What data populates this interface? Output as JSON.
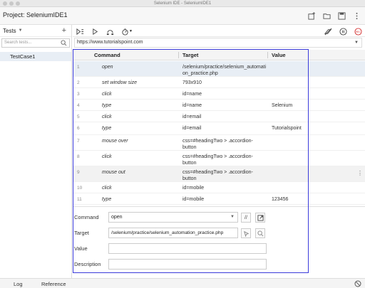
{
  "window": {
    "title": "Selenium IDE - SeleniumIDE1"
  },
  "project": {
    "label": "Project:",
    "name": "SeleniumIDE1"
  },
  "sidebar": {
    "tests_label": "Tests",
    "search_placeholder": "Search tests...",
    "test_cases": [
      "TestCase1"
    ]
  },
  "url": {
    "value": "https://www.tutorialspoint.com"
  },
  "grid": {
    "headers": {
      "command": "Command",
      "target": "Target",
      "value": "Value"
    },
    "rows": [
      {
        "num": "1",
        "command": "open",
        "target": "/selenium/practice/selenium_automation_practice.php",
        "value": ""
      },
      {
        "num": "2",
        "command": "set window size",
        "target": "793x910",
        "value": ""
      },
      {
        "num": "3",
        "command": "click",
        "target": "id=name",
        "value": ""
      },
      {
        "num": "4",
        "command": "type",
        "target": "id=name",
        "value": "Selenium"
      },
      {
        "num": "5",
        "command": "click",
        "target": "id=email",
        "value": ""
      },
      {
        "num": "6",
        "command": "type",
        "target": "id=email",
        "value": "Tutorialspoint"
      },
      {
        "num": "7",
        "command": "mouse over",
        "target": "css=#headingTwo > .accordion-button",
        "value": ""
      },
      {
        "num": "8",
        "command": "click",
        "target": "css=#headingTwo > .accordion-button",
        "value": ""
      },
      {
        "num": "9",
        "command": "mouse out",
        "target": "css=#headingTwo > .accordion-button",
        "value": ""
      },
      {
        "num": "10",
        "command": "click",
        "target": "id=mobile",
        "value": ""
      },
      {
        "num": "11",
        "command": "type",
        "target": "id=mobile",
        "value": "123456"
      }
    ]
  },
  "editor": {
    "command_label": "Command",
    "command_value": "open",
    "comment_btn": "//",
    "target_label": "Target",
    "target_value": "/selenium/practice/selenium_automation_practice.php",
    "value_label": "Value",
    "value_value": "",
    "description_label": "Description",
    "description_value": ""
  },
  "bottom": {
    "log_tab": "Log",
    "reference_tab": "Reference"
  },
  "colors": {
    "selection": "#e8eef5",
    "highlight_box": "#3b3bdb",
    "rec": "#d32f2f"
  }
}
